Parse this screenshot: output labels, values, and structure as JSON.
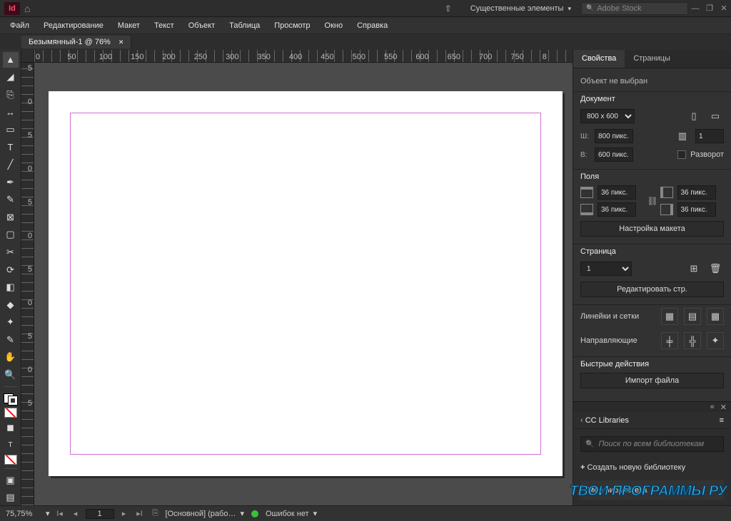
{
  "appbar": {
    "logo": "Id",
    "workspace": "Существенные элементы",
    "search_placeholder": "Adobe Stock"
  },
  "menu": [
    "Файл",
    "Редактирование",
    "Макет",
    "Текст",
    "Объект",
    "Таблица",
    "Просмотр",
    "Окно",
    "Справка"
  ],
  "doc_tab": "Безымянный-1 @ 76%",
  "ruler_h": [
    "0",
    "50",
    "100",
    "150",
    "200",
    "250",
    "300",
    "350",
    "400",
    "450",
    "500",
    "550",
    "600",
    "650",
    "700",
    "750",
    "8"
  ],
  "ruler_v": [
    "5",
    "0",
    "5",
    "0",
    "5",
    "0",
    "5",
    "0",
    "5",
    "0",
    "5"
  ],
  "panel_tabs": {
    "properties": "Свойства",
    "pages": "Страницы"
  },
  "properties": {
    "no_selection": "Объект не выбран",
    "document": "Документ",
    "preset": "800 x 600",
    "width_label": "Ш:",
    "width_value": "800 пикс.",
    "height_label": "В:",
    "height_value": "600 пикс.",
    "pages_count": "1",
    "facing_label": "Разворот",
    "margins": "Поля",
    "margin_val": "36 пикс.",
    "layout_btn": "Настройка макета",
    "page_section": "Страница",
    "page_num": "1",
    "edit_page_btn": "Редактировать стр.",
    "rulers_grids": "Линейки и сетки",
    "guides": "Направляющие",
    "quick_actions": "Быстрые действия",
    "import_btn": "Импорт файла"
  },
  "libraries": {
    "title": "CC Libraries",
    "search_placeholder": "Поиск по всем библиотекам",
    "create": "Создать новую библиотеку",
    "mylib": "Моя библиотека"
  },
  "status": {
    "zoom": "75,75%",
    "page": "1",
    "master": "[Основной] (рабо…",
    "errors": "Ошибок нет"
  },
  "watermark": "ТВОИ ПРОГРАММЫ РУ"
}
